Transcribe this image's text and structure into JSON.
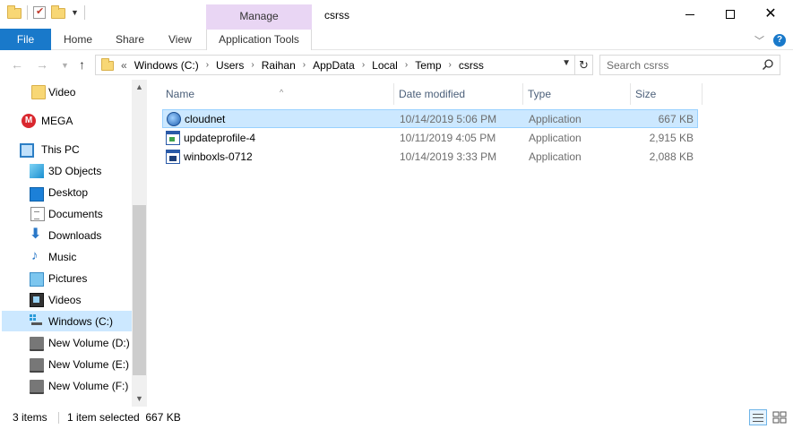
{
  "window": {
    "title": "csrss",
    "contextual_group": "Manage",
    "controls": {
      "minimize": "minimize-icon",
      "maximize": "maximize-icon",
      "close": "close-icon"
    }
  },
  "ribbon": {
    "tabs": [
      {
        "label": "File"
      },
      {
        "label": "Home"
      },
      {
        "label": "Share"
      },
      {
        "label": "View"
      },
      {
        "label": "Application Tools"
      }
    ]
  },
  "address": {
    "overflow": "«",
    "crumbs": [
      "Windows (C:)",
      "Users",
      "Raihan",
      "AppData",
      "Local",
      "Temp",
      "csrss"
    ]
  },
  "search": {
    "placeholder": "Search csrss",
    "value": ""
  },
  "navpane": {
    "items": [
      {
        "label": "Video",
        "icon": "folder-icon"
      },
      {
        "label": "MEGA",
        "icon": "mega-icon"
      },
      {
        "label": "This PC",
        "icon": "this-pc-icon"
      },
      {
        "label": "3D Objects",
        "icon": "3d-objects-icon"
      },
      {
        "label": "Desktop",
        "icon": "desktop-icon"
      },
      {
        "label": "Documents",
        "icon": "documents-icon"
      },
      {
        "label": "Downloads",
        "icon": "downloads-icon"
      },
      {
        "label": "Music",
        "icon": "music-icon"
      },
      {
        "label": "Pictures",
        "icon": "pictures-icon"
      },
      {
        "label": "Videos",
        "icon": "videos-icon"
      },
      {
        "label": "Windows (C:)",
        "icon": "drive-c-icon",
        "selected": true
      },
      {
        "label": "New Volume (D:)",
        "icon": "drive-icon"
      },
      {
        "label": "New Volume (E:)",
        "icon": "drive-icon"
      },
      {
        "label": "New Volume (F:)",
        "icon": "drive-icon"
      }
    ]
  },
  "filelist": {
    "columns": [
      "Name",
      "Date modified",
      "Type",
      "Size"
    ],
    "rows": [
      {
        "name": "cloudnet",
        "date": "10/14/2019 5:06 PM",
        "type": "Application",
        "size": "667 KB",
        "icon": "globe-app-icon",
        "selected": true
      },
      {
        "name": "updateprofile-4",
        "date": "10/11/2019 4:05 PM",
        "type": "Application",
        "size": "2,915 KB",
        "icon": "application-icon"
      },
      {
        "name": "winboxls-0712",
        "date": "10/14/2019 3:33 PM",
        "type": "Application",
        "size": "2,088 KB",
        "icon": "window-app-icon"
      }
    ]
  },
  "status": {
    "count": "3 items",
    "selection": "1 item selected  667 KB"
  },
  "colors": {
    "file_tab": "#1979ca",
    "contextual_tab": "#e9d6f4",
    "selection": "#cce8ff"
  }
}
